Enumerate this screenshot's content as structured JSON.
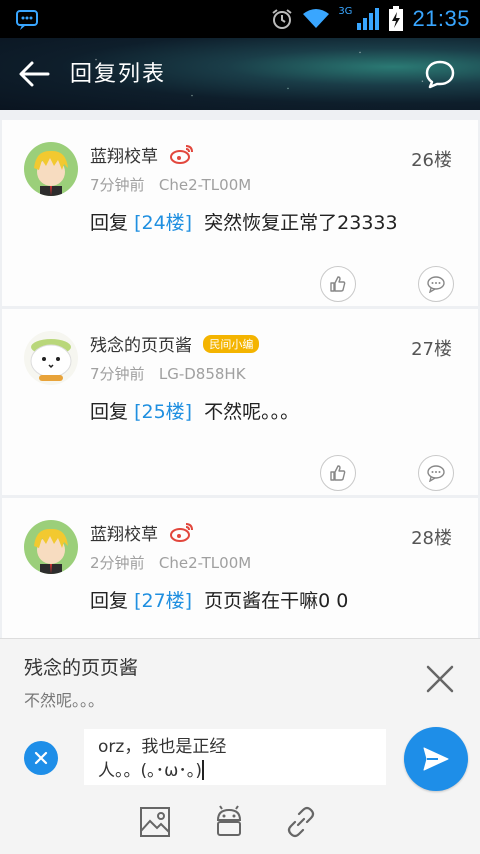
{
  "status_bar": {
    "network": "3G",
    "time": "21:35",
    "accent_color": "#39a6ff"
  },
  "app_bar": {
    "title": "回复列表",
    "back_icon": "arrow-left-icon",
    "action_icon": "chat-bubble-icon"
  },
  "replies": [
    {
      "username": "蓝翔校草",
      "badge": "",
      "has_weibo": true,
      "time": "7分钟前",
      "device": "Che2-TL00M",
      "floor": "26楼",
      "reply_prefix": "回复",
      "reply_ref": "[24楼]",
      "text": "突然恢复正常了23333"
    },
    {
      "username": "残念的页页酱",
      "badge": "民间小编",
      "has_weibo": false,
      "time": "7分钟前",
      "device": "LG-D858HK",
      "floor": "27楼",
      "reply_prefix": "回复",
      "reply_ref": "[25楼]",
      "text": "不然呢。。。"
    },
    {
      "username": "蓝翔校草",
      "badge": "",
      "has_weibo": true,
      "time": "2分钟前",
      "device": "Che2-TL00M",
      "floor": "28楼",
      "reply_prefix": "回复",
      "reply_ref": "[27楼]",
      "text": "页页酱在干嘛0 0"
    }
  ],
  "composer": {
    "quote_name": "残念的页页酱",
    "quote_text": "不然呢。。。",
    "input_line1": "orz，我也是正经",
    "input_line2": "人。。(｡･ω･｡)",
    "tools": [
      "image-icon",
      "android-icon",
      "link-icon"
    ]
  },
  "colors": {
    "accent": "#1e8ee8",
    "reference": "#1f8fe0",
    "badge": "#f4b400"
  }
}
